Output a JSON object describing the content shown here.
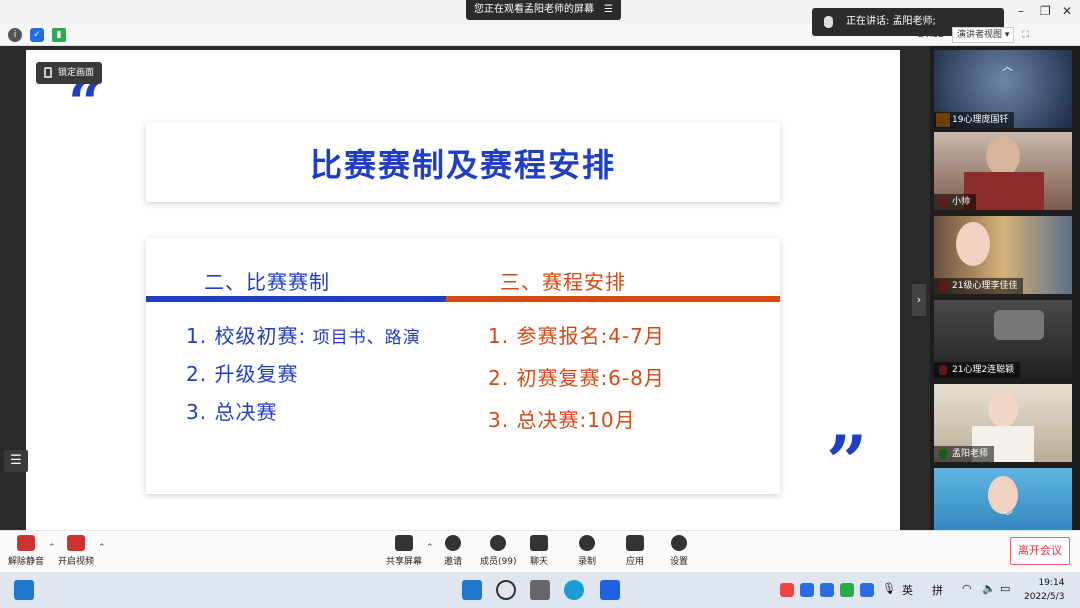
{
  "topbar": {
    "viewing_text": "您正在观看孟阳老师的屏幕",
    "speaking_text": "正在讲话: 孟阳老师;",
    "timer": "24:32",
    "view_mode": "演讲者视图"
  },
  "slide": {
    "lock_label": "锁定画面",
    "quote_open": "“",
    "quote_close": "”",
    "title": "比赛赛制及赛程安排",
    "left_heading": "二、比赛赛制",
    "right_heading": "三、赛程安排",
    "left_items": [
      {
        "main": "1. 校级初赛:",
        "sub": " 项目书、路演"
      },
      {
        "main": "2. 升级复赛",
        "sub": ""
      },
      {
        "main": "3. 总决赛",
        "sub": ""
      }
    ],
    "right_items": [
      "1. 参赛报名:4-7月",
      "2. 初赛复赛:6-8月",
      "3. 总决赛:10月"
    ]
  },
  "participants": [
    {
      "name": "19心理庞国钎",
      "bg": "#2e3d58"
    },
    {
      "name": "小帅",
      "bg": "#8f7a6a"
    },
    {
      "name": "21级心理李佳佳",
      "bg": "#c7a46a"
    },
    {
      "name": "21心理2连聪颖",
      "bg": "#3a3a3a"
    },
    {
      "name": "孟阳老师",
      "bg": "#cfc7b9"
    },
    {
      "name": "",
      "bg": "#4aa3d0"
    }
  ],
  "controls": {
    "unmute": "解除静音",
    "start_video": "开启视频",
    "share": "共享屏幕",
    "invite": "邀请",
    "members": "成员(99)",
    "chat": "聊天",
    "record": "录制",
    "apps": "应用",
    "settings": "设置",
    "leave": "离开会议"
  },
  "taskbar": {
    "ime_lang": "英",
    "ime_mode": "拼",
    "time": "19:14",
    "date": "2022/5/3"
  }
}
